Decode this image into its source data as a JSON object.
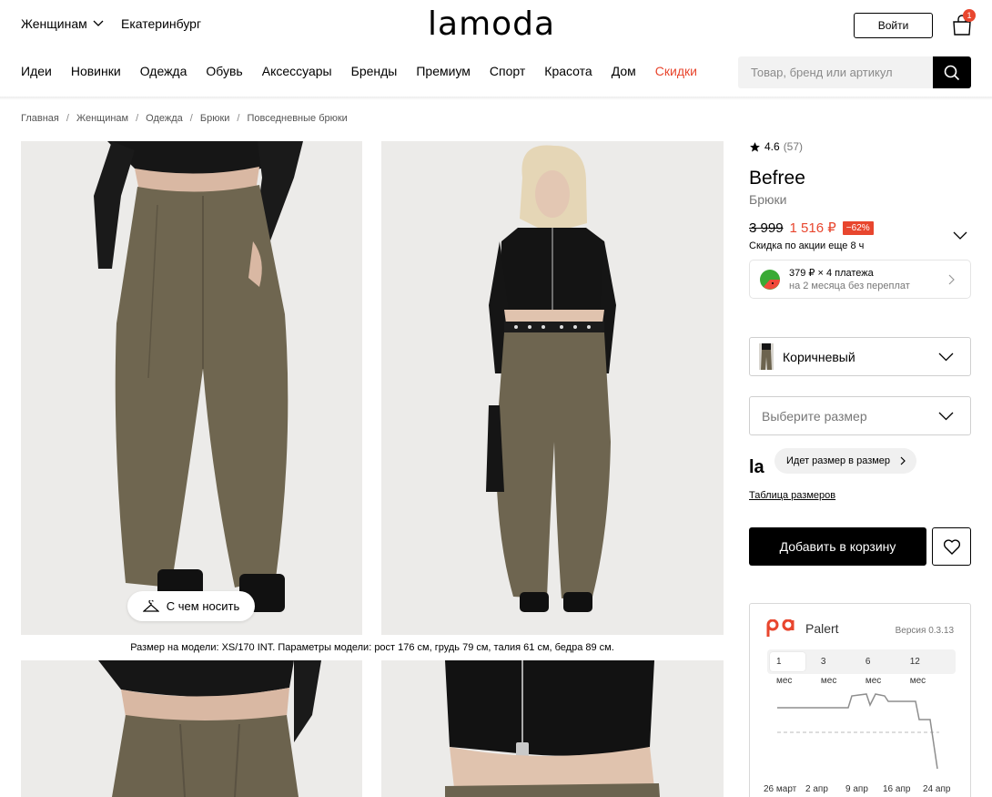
{
  "header": {
    "gender": "Женщинам",
    "city": "Екатеринбург",
    "logo": "lamoda",
    "login": "Войти",
    "cart_count": "1"
  },
  "nav": {
    "items": [
      "Идеи",
      "Новинки",
      "Одежда",
      "Обувь",
      "Аксессуары",
      "Бренды",
      "Премиум",
      "Спорт",
      "Красота",
      "Дом",
      "Скидки"
    ],
    "sale_color": "#e8462e"
  },
  "search": {
    "placeholder": "Товар, бренд или артикул"
  },
  "breadcrumbs": [
    "Главная",
    "Женщинам",
    "Одежда",
    "Брюки",
    "Повседневные брюки"
  ],
  "gallery": {
    "wear_button": "С чем носить",
    "model_info": "Размер на модели: XS/170 INT. Параметры модели: рост 176 см, грудь 79 см, талия 61 см, бедра 89 см."
  },
  "product": {
    "rating": "4.6",
    "reviews": "(57)",
    "brand": "Befree",
    "category": "Брюки",
    "old_price": "3 999",
    "new_price": "1 516 ₽",
    "discount": "−62%",
    "promo": "Скидка по акции еще 8 ч",
    "split_line1": "379 ₽ × 4 платежа",
    "split_line2": "на 2 месяца без переплат",
    "color": "Коричневый",
    "size_placeholder": "Выберите размер",
    "la_badge": "la",
    "fit": "Идет размер в размер",
    "size_table": "Таблица размеров",
    "add_to_cart": "Добавить в корзину"
  },
  "palert": {
    "name": "Palert",
    "version": "Версия 0.3.13",
    "tabs": [
      "1 мес",
      "3 мес",
      "6 мес",
      "12 мес"
    ],
    "active_tab": 0,
    "x_labels": [
      "26 март",
      "2 апр",
      "9 апр",
      "16 апр",
      "24 апр"
    ],
    "brand_color": "#e8462e"
  }
}
